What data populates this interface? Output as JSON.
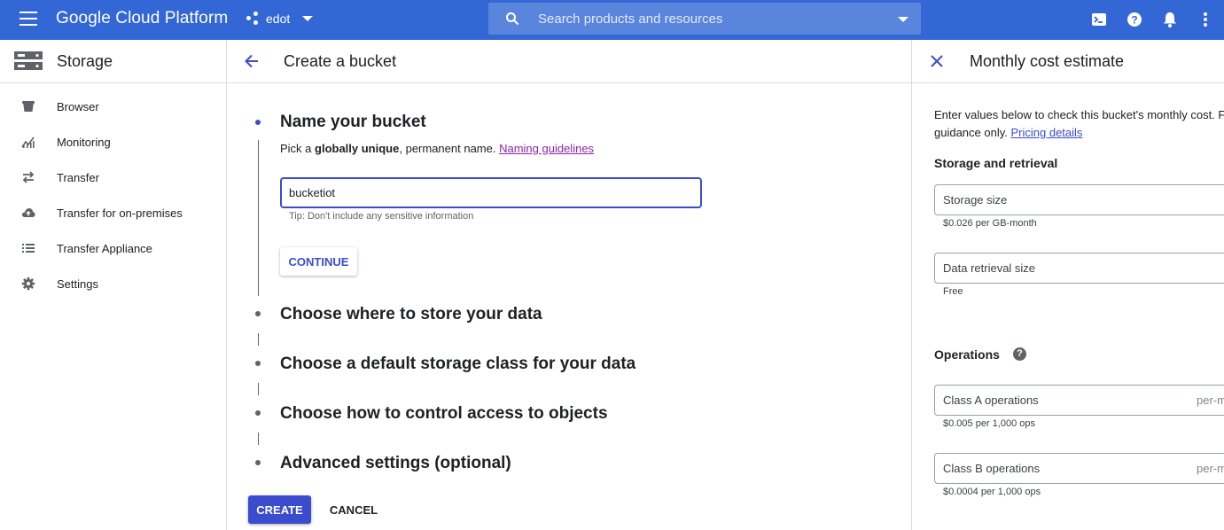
{
  "topbar": {
    "brand": "Google Cloud Platform",
    "project": "edot",
    "search_placeholder": "Search products and resources"
  },
  "leftnav": {
    "title": "Storage",
    "items": [
      {
        "label": "Browser",
        "icon": "bucket-icon"
      },
      {
        "label": "Monitoring",
        "icon": "chart-icon"
      },
      {
        "label": "Transfer",
        "icon": "transfer-arrows-icon"
      },
      {
        "label": "Transfer for on-premises",
        "icon": "cloud-upload-icon"
      },
      {
        "label": "Transfer Appliance",
        "icon": "list-icon"
      },
      {
        "label": "Settings",
        "icon": "gear-icon"
      }
    ]
  },
  "main": {
    "title": "Create a bucket",
    "step1": {
      "title": "Name your bucket",
      "desc_prefix": "Pick a ",
      "desc_bold": "globally unique",
      "desc_suffix": ", permanent name. ",
      "desc_link": "Naming guidelines",
      "name_value": "bucketiot",
      "tip": "Tip: Don't include any sensitive information",
      "continue_label": "CONTINUE"
    },
    "steps": [
      "Choose where to store your data",
      "Choose a default storage class for your data",
      "Choose how to control access to objects",
      "Advanced settings (optional)"
    ],
    "create_label": "CREATE",
    "cancel_label": "CANCEL"
  },
  "rpanel": {
    "title": "Monthly cost estimate",
    "intro_line1": "Enter values below to check this bucket's monthly cost. F",
    "intro_line2": "guidance only. ",
    "intro_link": "Pricing details",
    "storage_section": "Storage and retrieval",
    "storage_size_placeholder": "Storage size",
    "storage_size_note": "$0.026 per GB-month",
    "retrieval_placeholder": "Data retrieval size",
    "retrieval_note": "Free",
    "operations_section": "Operations",
    "class_a_placeholder": "Class A operations",
    "class_a_suffix": "per-m",
    "class_a_note": "$0.005 per 1,000 ops",
    "class_b_placeholder": "Class B operations",
    "class_b_suffix": "per-m",
    "class_b_note": "$0.0004 per 1,000 ops"
  },
  "colors": {
    "topbar": "#3367d6",
    "accent": "#3c4ccf",
    "link_visited": "#8e24aa"
  }
}
